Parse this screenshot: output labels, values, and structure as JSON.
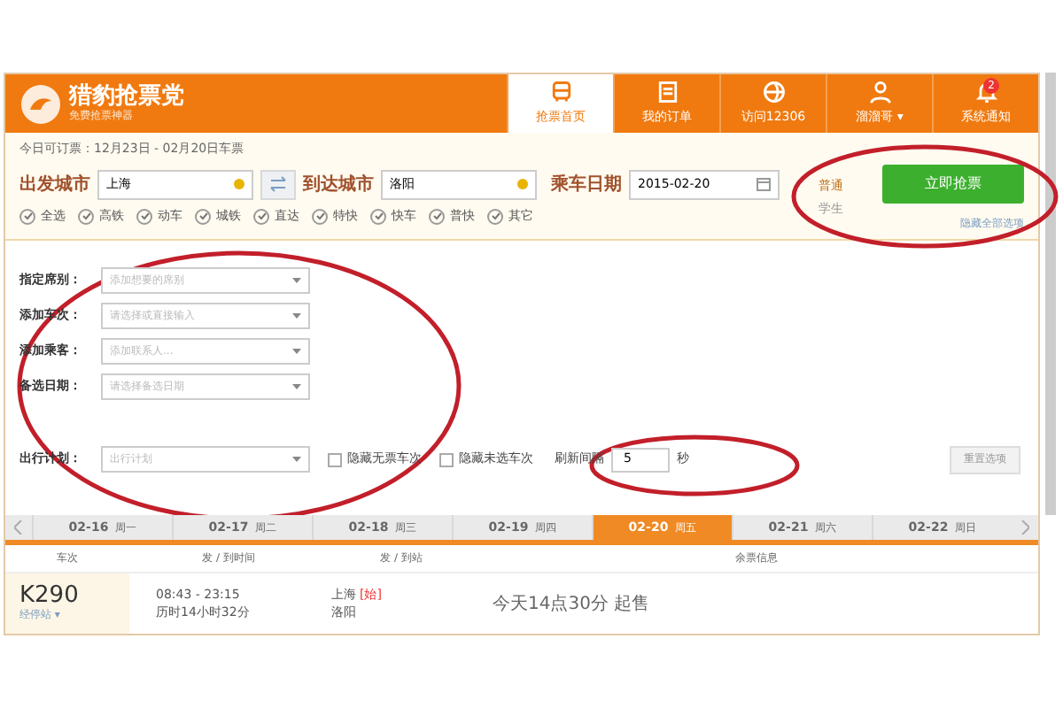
{
  "app": {
    "logo_title": "猎豹抢票党",
    "logo_subtitle": "免费抢票神器"
  },
  "nav": [
    {
      "label": "抢票首页",
      "selected": true
    },
    {
      "label": "我的订单",
      "selected": false
    },
    {
      "label": "访问12306",
      "selected": false
    },
    {
      "label": "溜溜哥 ▾",
      "selected": false
    },
    {
      "label": "系统通知",
      "selected": false,
      "badge": "2"
    }
  ],
  "booking_range": "今日可订票：12月23日 - 02月20日车票",
  "from": {
    "label": "出发城市",
    "value": "上海"
  },
  "to": {
    "label": "到达城市",
    "value": "洛阳"
  },
  "date": {
    "label": "乘车日期",
    "value": "2015-02-20"
  },
  "passenger_types": [
    {
      "label": "普通",
      "selected": true
    },
    {
      "label": "学生",
      "selected": false
    }
  ],
  "grab_button": "立即抢票",
  "train_types": [
    {
      "label": "全选",
      "checked": true
    },
    {
      "label": "高铁",
      "checked": true
    },
    {
      "label": "动车",
      "checked": true
    },
    {
      "label": "城铁",
      "checked": true
    },
    {
      "label": "直达",
      "checked": true
    },
    {
      "label": "特快",
      "checked": true
    },
    {
      "label": "快车",
      "checked": true
    },
    {
      "label": "普快",
      "checked": true
    },
    {
      "label": "其它",
      "checked": true
    }
  ],
  "hide_options_link": "隐藏全部选项",
  "options": [
    {
      "label": "指定席别：",
      "placeholder": "添加想要的席别"
    },
    {
      "label": "添加车次：",
      "placeholder": "请选择或直接输入"
    },
    {
      "label": "添加乘客：",
      "placeholder": "添加联系人..."
    },
    {
      "label": "备选日期：",
      "placeholder": "请选择备选日期"
    },
    {
      "label": "出行计划：",
      "placeholder": "出行计划"
    }
  ],
  "hide_checks": [
    {
      "label": "隐藏无票车次",
      "checked": false
    },
    {
      "label": "隐藏未选车次",
      "checked": false
    }
  ],
  "refresh": {
    "label": "刷新间隔",
    "value": "5",
    "unit": "秒"
  },
  "reset_button": "重置选项",
  "dates": [
    {
      "date": "02-16",
      "day": "周一",
      "selected": false
    },
    {
      "date": "02-17",
      "day": "周二",
      "selected": false
    },
    {
      "date": "02-18",
      "day": "周三",
      "selected": false
    },
    {
      "date": "02-19",
      "day": "周四",
      "selected": false
    },
    {
      "date": "02-20",
      "day": "周五",
      "selected": true
    },
    {
      "date": "02-21",
      "day": "周六",
      "selected": false
    },
    {
      "date": "02-22",
      "day": "周日",
      "selected": false
    }
  ],
  "table": {
    "columns": [
      "车次",
      "发 / 到时间",
      "发 / 到站",
      "余票信息"
    ],
    "rows": [
      {
        "train": "K290",
        "stops": "经停站 ▾",
        "times": "08:43 - 23:15",
        "duration": "历时14小时32分",
        "from": "上海",
        "from_tag": "[始]",
        "to": "洛阳",
        "status": "今天14点30分 起售"
      }
    ]
  }
}
